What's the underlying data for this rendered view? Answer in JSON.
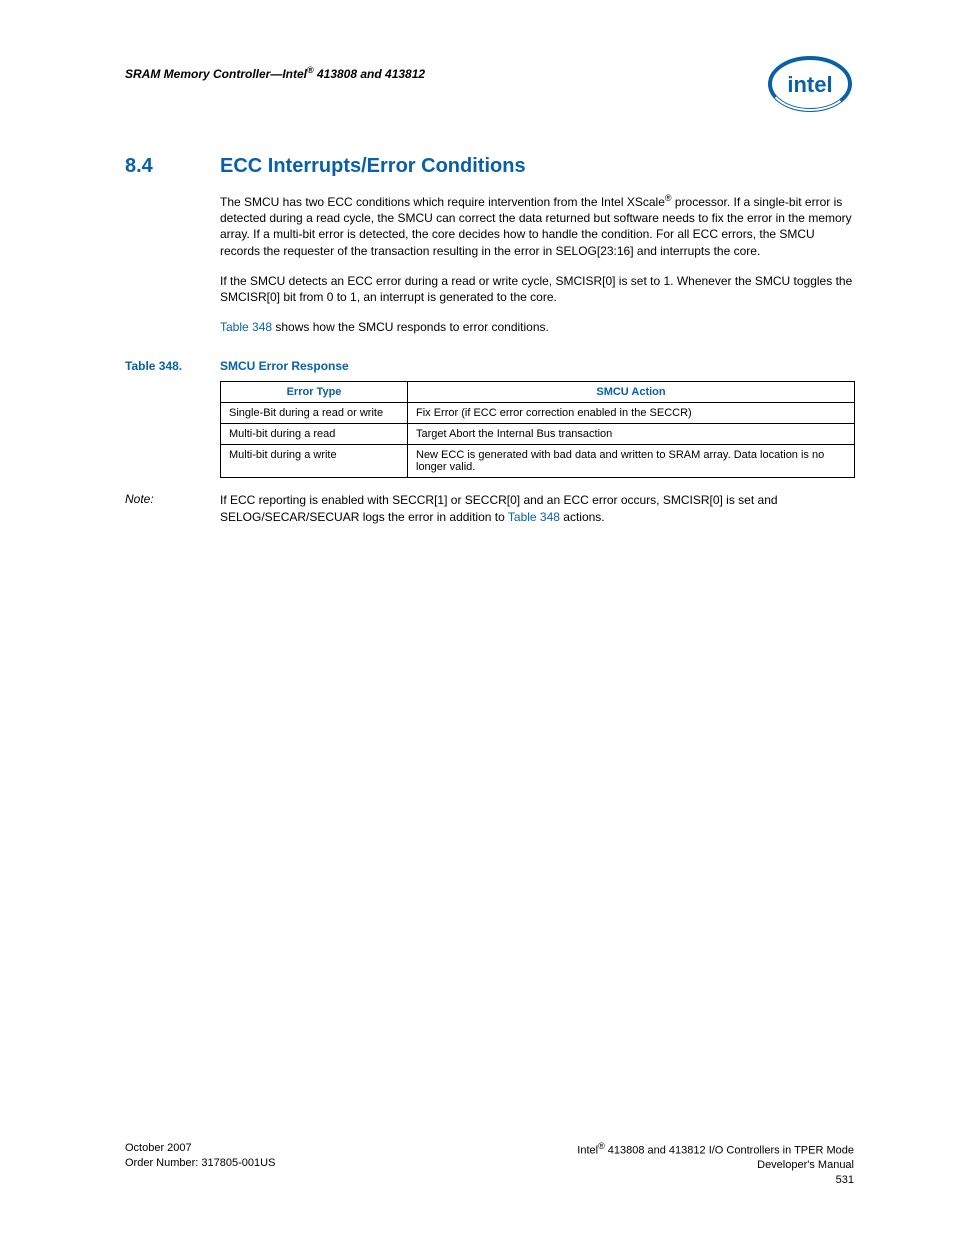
{
  "header": {
    "running_title_prefix": "SRAM Memory Controller—Intel",
    "running_title_suffix": " 413808 and 413812"
  },
  "section": {
    "number": "8.4",
    "title": "ECC Interrupts/Error Conditions"
  },
  "paragraphs": {
    "p1a": "The SMCU has two ECC conditions which require intervention from the Intel XScale",
    "p1b": " processor. If a single-bit error is detected during a read cycle, the SMCU can correct the data returned but software needs to fix the error in the memory array. If a multi-bit error is detected, the core decides how to handle the condition. For all ECC errors, the SMCU records the requester of the transaction resulting in the error in SELOG[23:16] and interrupts the core.",
    "p2": "If the SMCU detects an ECC error during a read or write cycle, SMCISR[0] is set to 1. Whenever the SMCU toggles the SMCISR[0] bit from 0 to 1, an interrupt is generated to the core.",
    "p3_ref": "Table 348",
    "p3_rest": " shows how the SMCU responds to error conditions."
  },
  "table": {
    "label": "Table 348.",
    "title": "SMCU Error Response",
    "headers": {
      "col1": "Error Type",
      "col2": "SMCU Action"
    },
    "rows": [
      {
        "type": "Single-Bit during a read or write",
        "action": "Fix Error (if ECC error correction enabled in the SECCR)"
      },
      {
        "type": "Multi-bit during a read",
        "action": "Target Abort the Internal Bus transaction"
      },
      {
        "type": "Multi-bit during a write",
        "action": "New ECC is generated with bad data and written to SRAM array. Data location is no longer valid."
      }
    ]
  },
  "note": {
    "label": "Note:",
    "body_a": "If ECC reporting is enabled with SECCR[1] or SECCR[0] and an ECC error occurs, SMCISR[0] is set and SELOG/SECAR/SECUAR logs the error in addition to ",
    "body_ref": "Table 348",
    "body_b": " actions."
  },
  "footer": {
    "left_line1": "October 2007",
    "left_line2": "Order Number: 317805-001US",
    "right_line1_a": "Intel",
    "right_line1_b": " 413808 and 413812 I/O Controllers in TPER Mode",
    "right_line2": "Developer's Manual",
    "right_line3": "531"
  }
}
